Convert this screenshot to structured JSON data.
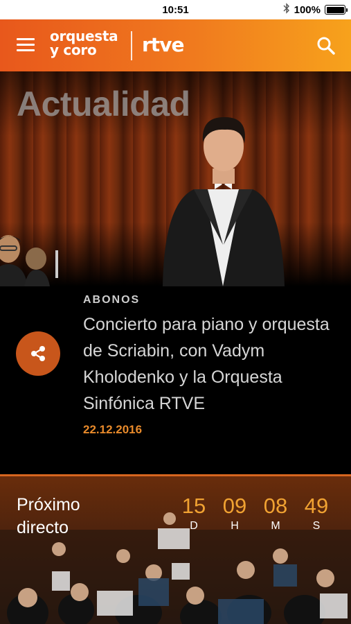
{
  "status_bar": {
    "time": "10:51",
    "battery": "100%",
    "bluetooth_icon": "bluetooth-icon"
  },
  "header": {
    "menu_icon": "hamburger-menu-icon",
    "logo_line1": "orquesta",
    "logo_line2": "y coro",
    "brand": "rtve",
    "search_icon": "search-icon",
    "gradient_colors": [
      "#e8581c",
      "#f7a21c"
    ]
  },
  "hero": {
    "section_title": "Actualidad"
  },
  "article": {
    "category": "ABONOS",
    "headline": "Concierto para piano y orquesta de Scriabin, con Vadym Kholodenko y la Orquesta Sinfónica RTVE",
    "date": "22.12.2016",
    "date_color": "#e88a2b",
    "share_icon": "share-icon",
    "share_color": "#c8561b"
  },
  "next_live": {
    "title_line1": "Próximo",
    "title_line2": "directo",
    "countdown": [
      {
        "value": "15",
        "label": "D"
      },
      {
        "value": "09",
        "label": "H"
      },
      {
        "value": "08",
        "label": "M"
      },
      {
        "value": "49",
        "label": "S"
      }
    ],
    "countdown_color": "#f0a232"
  }
}
